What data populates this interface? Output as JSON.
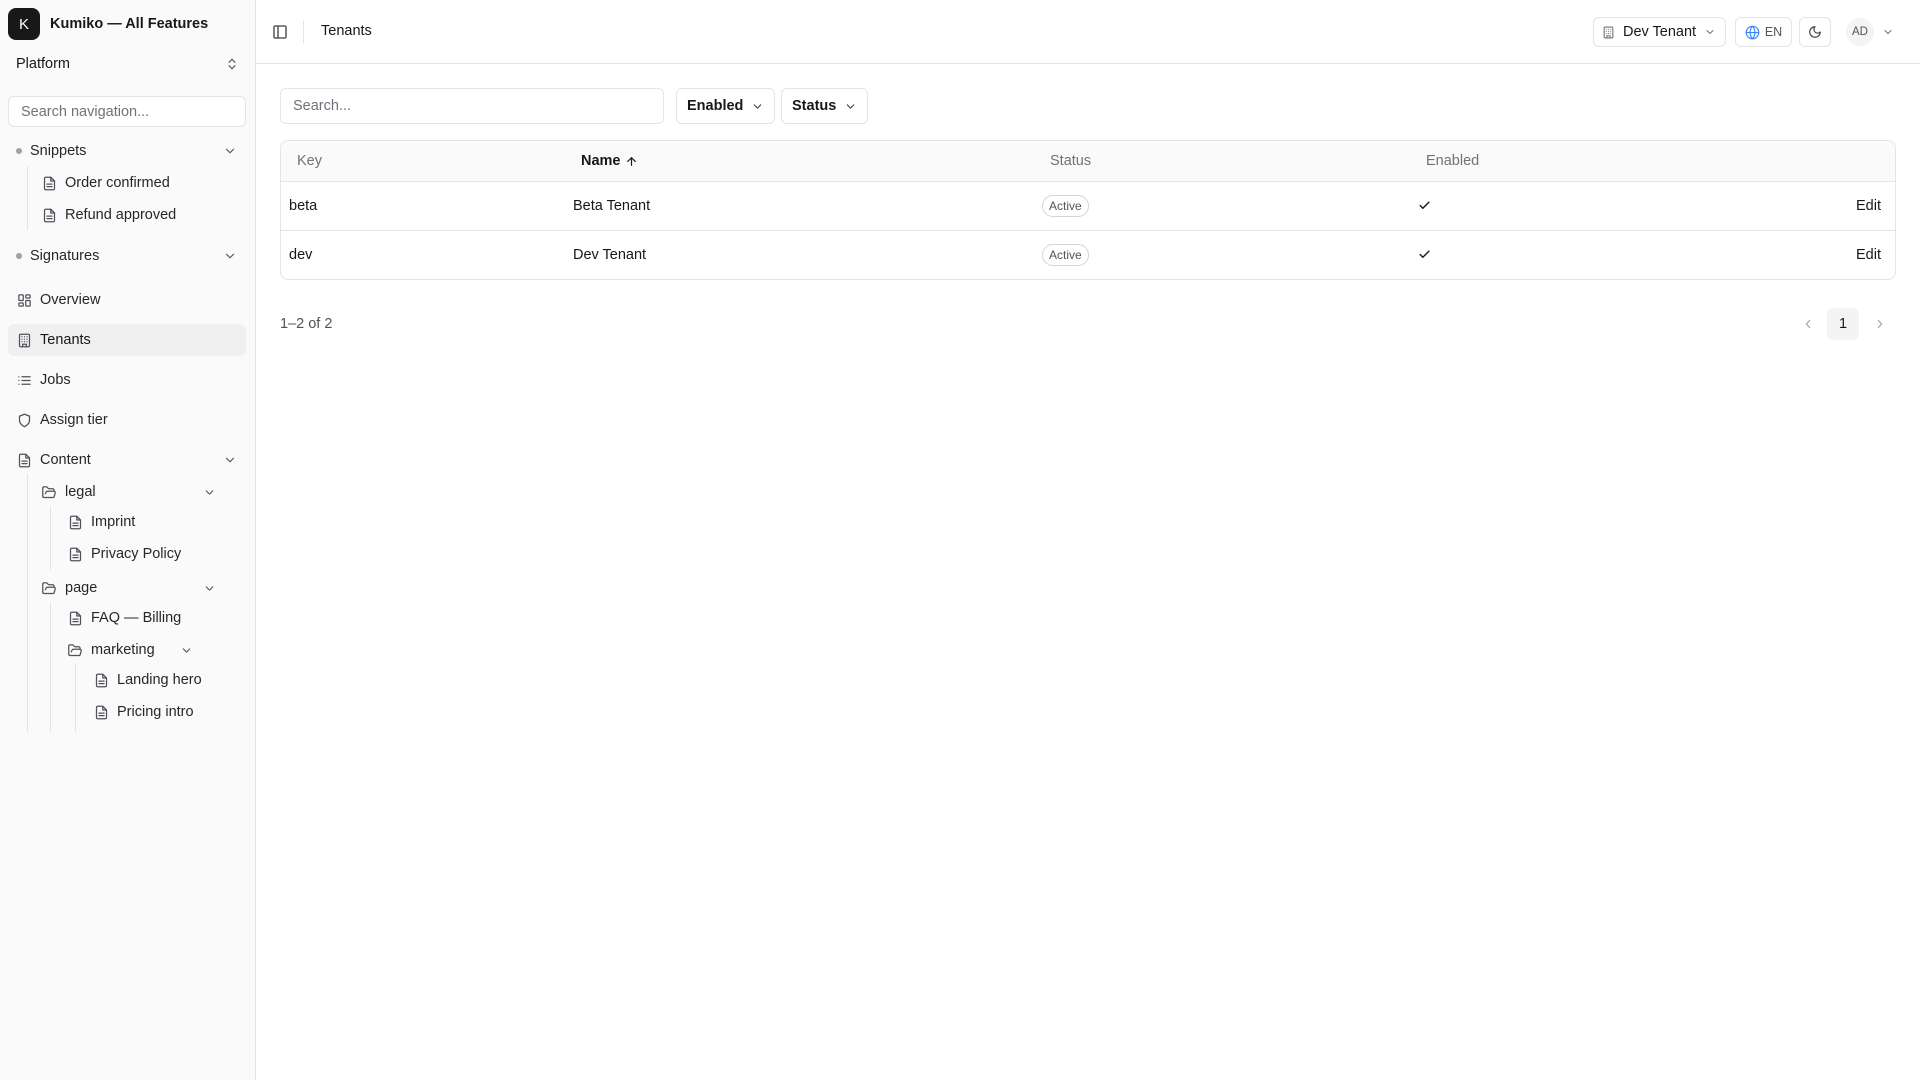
{
  "app": {
    "logo_letter": "K",
    "title": "Kumiko — All Features"
  },
  "sidebar": {
    "workspace": "Platform",
    "search_placeholder": "Search navigation...",
    "snippets": {
      "label": "Snippets",
      "items": [
        "Order confirmed",
        "Refund approved"
      ]
    },
    "signatures": {
      "label": "Signatures"
    },
    "nav": {
      "overview": "Overview",
      "tenants": "Tenants",
      "jobs": "Jobs",
      "assign_tier": "Assign tier"
    },
    "content": {
      "label": "Content",
      "legal": {
        "label": "legal",
        "items": [
          "Imprint",
          "Privacy Policy"
        ]
      },
      "page": {
        "label": "page",
        "faq": "FAQ — Billing",
        "marketing": {
          "label": "marketing",
          "items": [
            "Landing hero",
            "Pricing intro"
          ]
        }
      }
    }
  },
  "header": {
    "breadcrumb": "Tenants",
    "tenant_switcher": "Dev Tenant",
    "language": "EN",
    "avatar_initials": "AD"
  },
  "toolbar": {
    "search_placeholder": "Search...",
    "filter_enabled": "Enabled",
    "filter_status": "Status"
  },
  "table": {
    "columns": {
      "key": "Key",
      "name": "Name",
      "status": "Status",
      "enabled": "Enabled"
    },
    "sort": {
      "column": "Name",
      "direction": "asc"
    },
    "rows": [
      {
        "key": "beta",
        "name": "Beta Tenant",
        "status": "Active",
        "enabled": true,
        "action": "Edit"
      },
      {
        "key": "dev",
        "name": "Dev Tenant",
        "status": "Active",
        "enabled": true,
        "action": "Edit"
      }
    ]
  },
  "pagination": {
    "summary": "1–2 of 2",
    "current_page": "1"
  },
  "icons": {
    "sidebar": [
      "dot-icon",
      "file-icon",
      "layout-grid-icon",
      "building-icon",
      "list-icon",
      "shield-icon",
      "folder-open-icon",
      "chevron-down-icon",
      "chevrons-up-down-icon"
    ],
    "header": [
      "panel-left-icon",
      "building-icon",
      "globe-icon",
      "moon-icon",
      "chevron-down-icon"
    ],
    "table": [
      "arrow-up-icon",
      "check-icon"
    ]
  }
}
